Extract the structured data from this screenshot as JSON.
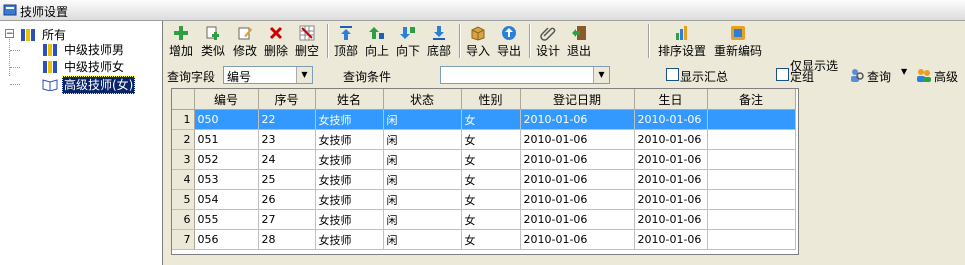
{
  "window": {
    "title": "技师设置"
  },
  "tree": {
    "root": "所有",
    "children": [
      "中级技师男",
      "中级技师女",
      "高级技师(女)"
    ],
    "selected_index": 2
  },
  "toolbar": {
    "buttons": [
      "增加",
      "类似",
      "修改",
      "删除",
      "删空",
      "顶部",
      "向上",
      "向下",
      "底部",
      "导入",
      "导出",
      "设计",
      "退出",
      "排序设置",
      "重新编码"
    ]
  },
  "query": {
    "field_label": "查询字段",
    "field_value": "编号",
    "condition_label": "查询条件",
    "condition_value": "",
    "show_summary": "显示汇总",
    "only_show_selected": "仅显示选定组",
    "query_button": "查询",
    "advanced_button": "高级"
  },
  "table": {
    "columns": [
      "编号",
      "序号",
      "姓名",
      "状态",
      "性别",
      "登记日期",
      "生日",
      "备注"
    ],
    "rows": [
      [
        "1",
        "050",
        "22",
        "女技师",
        "闲",
        "女",
        "2010-01-06",
        "2010-01-06",
        ""
      ],
      [
        "2",
        "051",
        "23",
        "女技师",
        "闲",
        "女",
        "2010-01-06",
        "2010-01-06",
        ""
      ],
      [
        "3",
        "052",
        "24",
        "女技师",
        "闲",
        "女",
        "2010-01-06",
        "2010-01-06",
        ""
      ],
      [
        "4",
        "053",
        "25",
        "女技师",
        "闲",
        "女",
        "2010-01-06",
        "2010-01-06",
        ""
      ],
      [
        "5",
        "054",
        "26",
        "女技师",
        "闲",
        "女",
        "2010-01-06",
        "2010-01-06",
        ""
      ],
      [
        "6",
        "055",
        "27",
        "女技师",
        "闲",
        "女",
        "2010-01-06",
        "2010-01-06",
        ""
      ],
      [
        "7",
        "056",
        "28",
        "女技师",
        "闲",
        "女",
        "2010-01-06",
        "2010-01-06",
        ""
      ]
    ],
    "selected_row": 0
  }
}
